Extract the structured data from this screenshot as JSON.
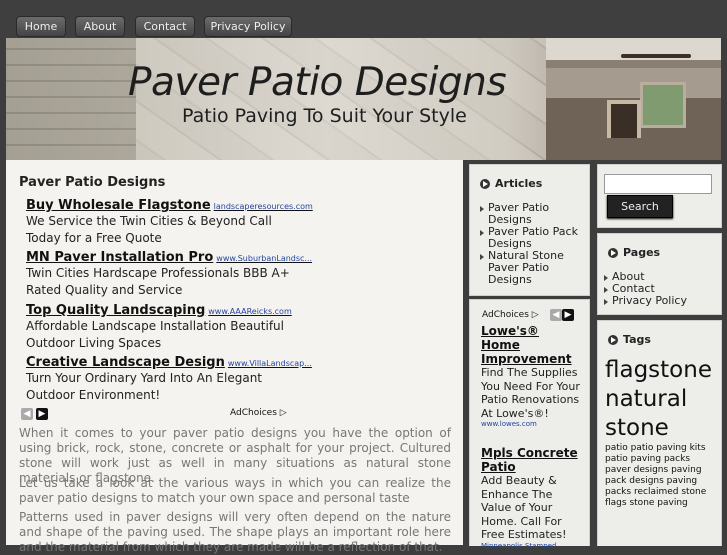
{
  "nav": {
    "items": [
      {
        "label": "Home"
      },
      {
        "label": "About"
      },
      {
        "label": "Contact"
      },
      {
        "label": "Privacy Policy"
      }
    ]
  },
  "header": {
    "title": "Paver Patio Designs",
    "subtitle": "Patio Paving To Suit Your Style"
  },
  "main": {
    "title": "Paver Patio Designs",
    "ads": [
      {
        "headline": "Buy Wholesale Flagstone",
        "url": "landscaperesources.com",
        "body": "We Service the Twin Cities & Beyond Call Today for a Free Quote"
      },
      {
        "headline": "MN Paver Installation Pro",
        "url": "www.SuburbanLandsc...",
        "body": "Twin Cities Hardscape Professionals BBB A+ Rated Quality and Service"
      },
      {
        "headline": "Top Quality Landscaping",
        "url": "www.AAAReicks.com",
        "body": "Affordable Landscape Installation Beautiful Outdoor Living Spaces"
      },
      {
        "headline": "Creative Landscape Design",
        "url": "www.VillaLandscap...",
        "body": "Turn Your Ordinary Yard Into An Elegant Outdoor Environment!"
      }
    ],
    "adchoices": "AdChoices",
    "paragraphs": [
      "When it comes to your paver patio designs you have the option of using brick, rock, stone, concrete or asphalt for your project. Cultured stone will work just as well in many situations as natural stone materials or flagstone.",
      "Let us take a look at the various ways in which you can realize the paver patio designs to match your own space and personal taste",
      "Patterns used in paver designs will very often depend on the nature and shape of the paving used. The shape plays an important role here and the material from which they are made will be a reflection of that."
    ]
  },
  "articles": {
    "title": "Articles",
    "items": [
      {
        "label": "Paver Patio Designs"
      },
      {
        "label": "Paver Patio Pack Designs"
      },
      {
        "label": "Natural Stone Paver Patio Designs"
      }
    ]
  },
  "sidebar_ads": {
    "adchoices": "AdChoices",
    "items": [
      {
        "headline": "Lowe's® Home Improvement",
        "body": "Find The Supplies You Need For Your Patio Renovations At Lowe's®!",
        "url": "www.lowes.com"
      },
      {
        "headline": "Mpls Concrete Patio",
        "body": "Add Beauty & Enhance The Value of Your Home. Call For Free Estimates!",
        "url": "Minneapolis Stamped..."
      }
    ]
  },
  "search": {
    "placeholder": "",
    "button_label": "Search"
  },
  "pages": {
    "title": "Pages",
    "items": [
      {
        "label": "About"
      },
      {
        "label": "Contact"
      },
      {
        "label": "Privacy Policy"
      }
    ]
  },
  "tags": {
    "title": "Tags",
    "items": [
      {
        "label": "flagstone",
        "size": "large"
      },
      {
        "label": "natural stone",
        "size": "large"
      },
      {
        "label": "patio",
        "size": "small"
      },
      {
        "label": "patio paving kits",
        "size": "small"
      },
      {
        "label": "patio paving packs",
        "size": "small"
      },
      {
        "label": "paver designs",
        "size": "small"
      },
      {
        "label": "paving pack designs",
        "size": "small"
      },
      {
        "label": "paving packs",
        "size": "small"
      },
      {
        "label": "reclaimed stone flags",
        "size": "small"
      },
      {
        "label": "stone paving",
        "size": "small"
      }
    ]
  }
}
